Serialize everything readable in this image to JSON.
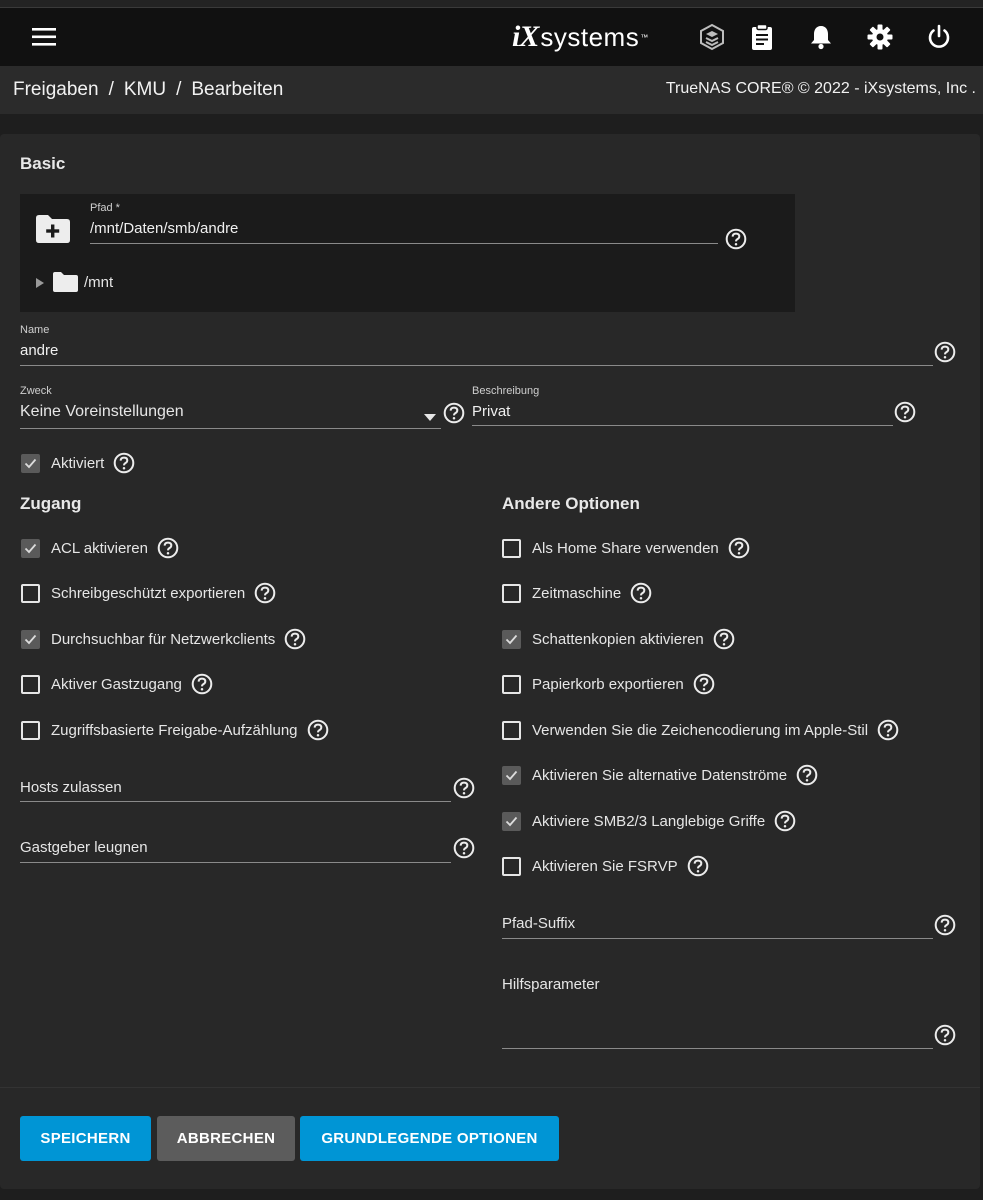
{
  "topbar": {
    "logo_ix": "iX",
    "logo_systems": "systems",
    "logo_tm": "™"
  },
  "breadcrumb": [
    "Freigaben",
    "KMU",
    "Bearbeiten"
  ],
  "breadcrumb_sep": "/",
  "copyright": "TrueNAS CORE® © 2022 - iXsystems, Inc .",
  "basic": {
    "title": "Basic",
    "path_label": "Pfad *",
    "path_value": "/mnt/Daten/smb/andre",
    "tree_root": "/mnt",
    "name_label": "Name",
    "name_value": "andre",
    "purpose_label": "Zweck",
    "purpose_value": "Keine Voreinstellungen",
    "description_label": "Beschreibung",
    "description_value": "Privat",
    "enabled_label": "Aktiviert",
    "enabled_checked": true
  },
  "access": {
    "title": "Zugang",
    "options": [
      {
        "label": "ACL aktivieren",
        "checked": true
      },
      {
        "label": "Schreibgeschützt exportieren",
        "checked": false
      },
      {
        "label": "Durchsuchbar für Netzwerkclients",
        "checked": true
      },
      {
        "label": "Aktiver Gastzugang",
        "checked": false
      },
      {
        "label": "Zugriffsbasierte Freigabe-Aufzählung",
        "checked": false
      }
    ],
    "hosts_allow": "Hosts zulassen",
    "hosts_deny": "Gastgeber leugnen"
  },
  "other": {
    "title": "Andere Optionen",
    "options": [
      {
        "label": "Als Home Share verwenden",
        "checked": false
      },
      {
        "label": "Zeitmaschine",
        "checked": false
      },
      {
        "label": "Schattenkopien aktivieren",
        "checked": true
      },
      {
        "label": "Papierkorb exportieren",
        "checked": false
      },
      {
        "label": "Verwenden Sie die Zeichencodierung im Apple-Stil",
        "checked": false
      },
      {
        "label": "Aktivieren Sie alternative Datenströme",
        "checked": true
      },
      {
        "label": "Aktiviere SMB2/3 Langlebige Griffe",
        "checked": true
      },
      {
        "label": "Aktivieren Sie FSRVP",
        "checked": false
      }
    ],
    "path_suffix": "Pfad-Suffix",
    "aux_params": "Hilfsparameter"
  },
  "buttons": {
    "save": "SPEICHERN",
    "cancel": "ABBRECHEN",
    "basic_options": "GRUNDLEGENDE OPTIONEN"
  },
  "colors": {
    "primary": "#0095d5",
    "secondary": "#5c5c5c",
    "card": "#282828",
    "topbar": "#111111"
  }
}
